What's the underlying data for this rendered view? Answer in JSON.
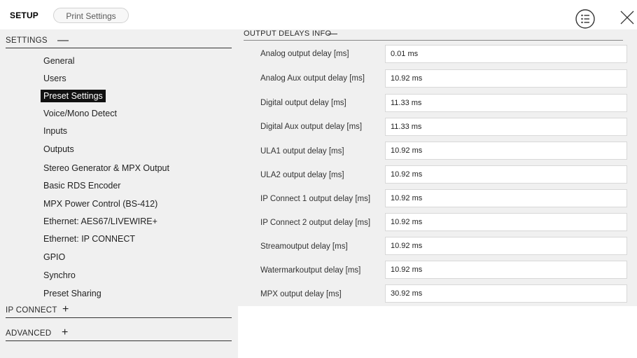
{
  "header": {
    "title": "SETUP",
    "tab_label": "Print Settings",
    "menu_icon": "list-menu-icon",
    "close_icon": "close-icon"
  },
  "sidebar": {
    "settings_section": {
      "label": "SETTINGS",
      "state": "—"
    },
    "items": [
      {
        "label": "General"
      },
      {
        "label": "Users"
      },
      {
        "label": "Preset Settings",
        "active": true
      },
      {
        "label": "Voice/Mono Detect"
      },
      {
        "label": "Inputs"
      },
      {
        "label": "Outputs"
      },
      {
        "label": "Stereo Generator & MPX Output"
      },
      {
        "label": "Basic RDS Encoder"
      },
      {
        "label": "MPX Power Control (BS-412)"
      },
      {
        "label": "Ethernet: AES67/LIVEWIRE+"
      },
      {
        "label": "Ethernet: IP CONNECT"
      },
      {
        "label": "GPIO"
      },
      {
        "label": "Synchro"
      },
      {
        "label": "Preset Sharing"
      }
    ],
    "ip_connect_section": {
      "label": "IP CONNECT",
      "state": "+"
    },
    "advanced_section": {
      "label": "ADVANCED",
      "state": "+"
    }
  },
  "main": {
    "section_title": "OUTPUT DELAYS INFO",
    "section_state": "—",
    "rows": [
      {
        "label": "Analog output delay [ms]",
        "value": "0.01 ms"
      },
      {
        "label": "Analog Aux output delay [ms]",
        "value": "10.92 ms"
      },
      {
        "label": "Digital output delay [ms]",
        "value": "11.33 ms"
      },
      {
        "label": "Digital Aux output delay [ms]",
        "value": "11.33 ms"
      },
      {
        "label": "ULA1 output delay [ms]",
        "value": "10.92 ms"
      },
      {
        "label": "ULA2 output delay [ms]",
        "value": "10.92 ms"
      },
      {
        "label": "IP Connect 1 output delay [ms]",
        "value": "10.92 ms"
      },
      {
        "label": "IP Connect 2 output delay [ms]",
        "value": "10.92 ms"
      },
      {
        "label": "Streamoutput delay [ms]",
        "value": "10.92 ms"
      },
      {
        "label": "Watermarkoutput delay [ms]",
        "value": "10.92 ms"
      },
      {
        "label": "MPX output delay [ms]",
        "value": "30.92 ms"
      }
    ]
  }
}
